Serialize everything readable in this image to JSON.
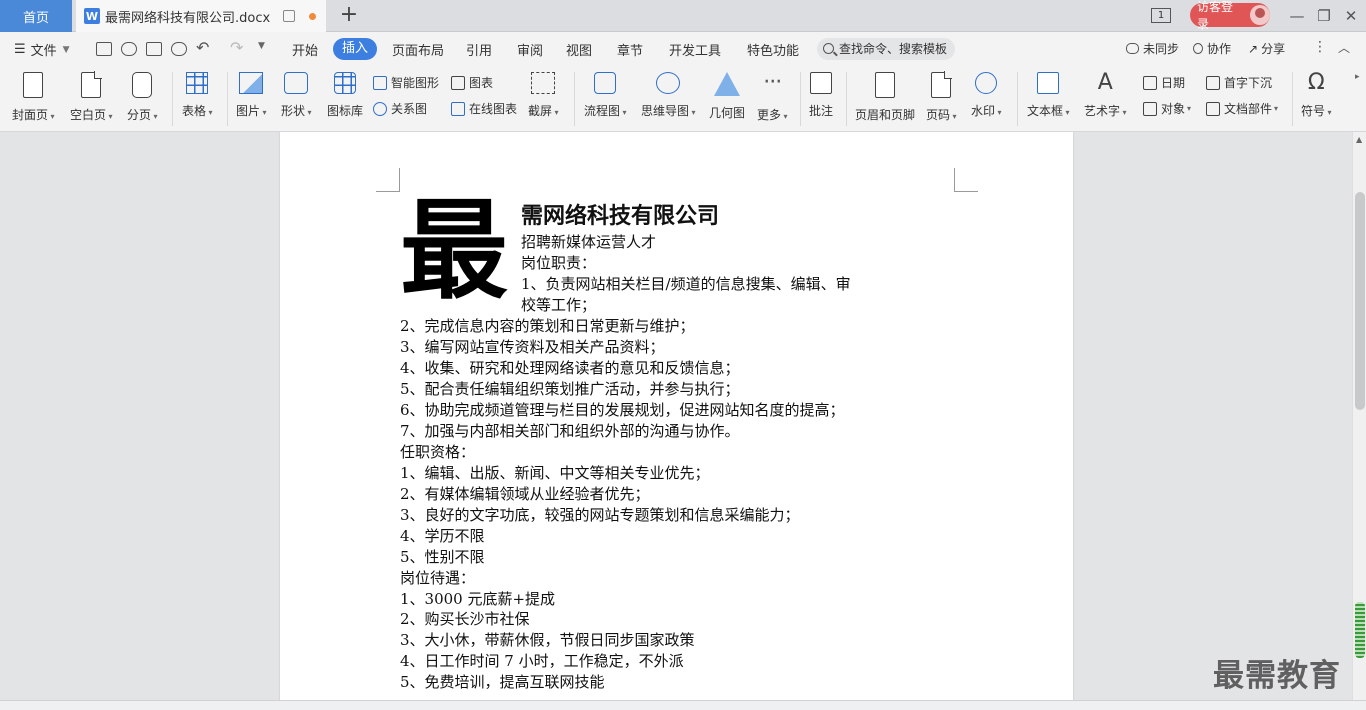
{
  "titlebar": {
    "home_tab": "首页",
    "doc_tab": "最需网络科技有限公司.docx",
    "page_indicator": "1",
    "login": "访客登录"
  },
  "menubar": {
    "file": "文件",
    "tabs": [
      "开始",
      "插入",
      "页面布局",
      "引用",
      "审阅",
      "视图",
      "章节",
      "开发工具",
      "特色功能"
    ],
    "active_tab": "插入",
    "search_placeholder": "查找命令、搜索模板",
    "sync": "未同步",
    "collab": "协作",
    "share": "分享"
  },
  "ribbon": {
    "cover": "封面页",
    "blank": "空白页",
    "pagebreak": "分页",
    "table": "表格",
    "picture": "图片",
    "shape": "形状",
    "iconlib": "图标库",
    "smartart": "智能图形",
    "chart": "图表",
    "relation": "关系图",
    "onlinechart": "在线图表",
    "screenshot": "截屏",
    "flowchart": "流程图",
    "mindmap": "思维导图",
    "geometry": "几何图",
    "more": "更多",
    "comment": "批注",
    "headerfooter": "页眉和页脚",
    "pagenum": "页码",
    "watermark": "水印",
    "textbox": "文本框",
    "wordart": "艺术字",
    "date": "日期",
    "object": "对象",
    "dropcap": "首字下沉",
    "docpart": "文档部件",
    "symbol": "符号"
  },
  "document": {
    "dropcap_char": "最",
    "company_rest": "需网络科技有限公司",
    "lines": [
      "招聘新媒体运营人才",
      "岗位职责：",
      "1、负责网站相关栏目/频道的信息搜集、编辑、审",
      "校等工作；",
      "2、完成信息内容的策划和日常更新与维护；",
      "3、编写网站宣传资料及相关产品资料；",
      "4、收集、研究和处理网络读者的意见和反馈信息；",
      "5、配合责任编辑组织策划推广活动，并参与执行；",
      "6、协助完成频道管理与栏目的发展规划，促进网站知名度的提高；",
      "7、加强与内部相关部门和组织外部的沟通与协作。",
      "任职资格：",
      "1、编辑、出版、新闻、中文等相关专业优先；",
      "2、有媒体编辑领域从业经验者优先；",
      "3、良好的文字功底，较强的网站专题策划和信息采编能力；",
      "4、学历不限",
      "5、性别不限",
      "岗位待遇：",
      "1、3000 元底薪+提成",
      "2、购买长沙市社保",
      "3、大小休，带薪休假，节假日同步国家政策",
      "4、日工作时间 7 小时，工作稳定，不外派",
      "5、免费培训，提高互联网技能"
    ]
  },
  "watermark": "最需教育"
}
